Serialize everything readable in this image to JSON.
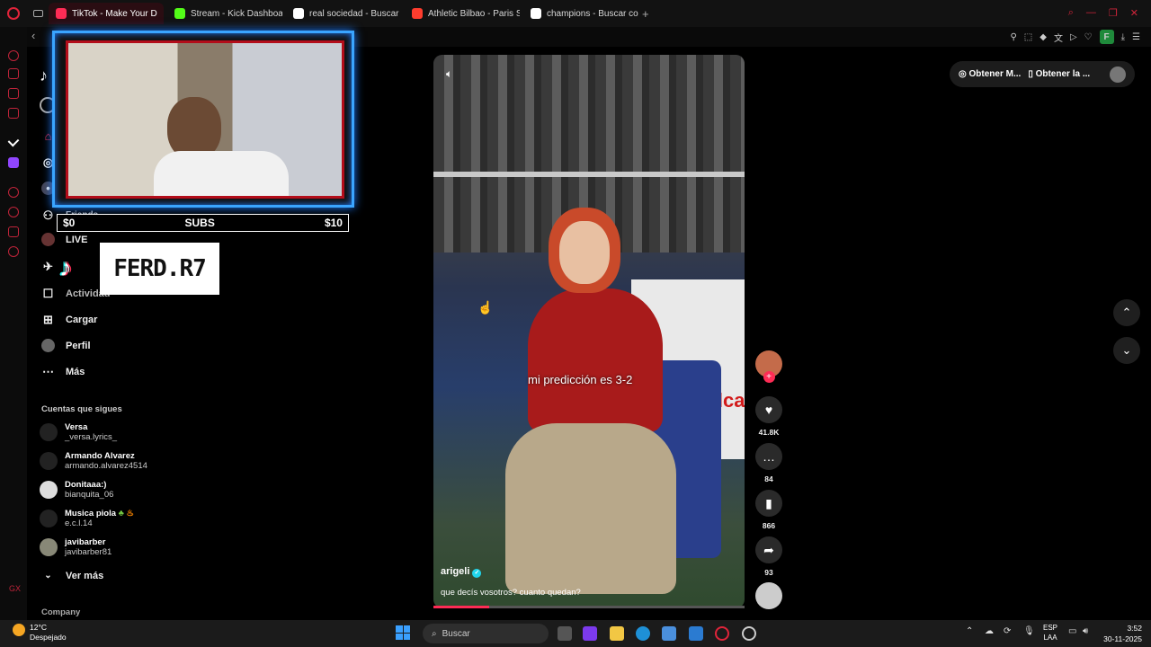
{
  "browser": {
    "tabs": [
      {
        "label": "TikTok - Make Your D",
        "color": "#fe2c55",
        "active": true
      },
      {
        "label": "Stream - Kick Dashboard",
        "color": "#53fc18",
        "active": false
      },
      {
        "label": "real sociedad - Buscar co",
        "color": "#ffffff",
        "active": false
      },
      {
        "label": "Athletic Bilbao - Paris Sai",
        "color": "#ff3d2e",
        "active": false
      },
      {
        "label": "champions - Buscar con",
        "color": "#ffffff",
        "active": false
      }
    ],
    "url": "tiktok.com"
  },
  "sidebar": {
    "nav": [
      {
        "label": "",
        "icon": "home-icon"
      },
      {
        "label": "",
        "icon": "explore-icon"
      },
      {
        "label": "Friends",
        "icon": "friends-icon"
      },
      {
        "label": "LIVE",
        "icon": "live-icon"
      },
      {
        "label": "Actividad",
        "icon": "activity-icon"
      },
      {
        "label": "Cargar",
        "icon": "upload-icon"
      },
      {
        "label": "Perfil",
        "icon": "profile-icon"
      },
      {
        "label": "Más",
        "icon": "more-icon"
      }
    ],
    "following_title": "Cuentas que sigues",
    "following": [
      {
        "name": "Versa",
        "handle": "_versa.lyrics_"
      },
      {
        "name": "Armando Alvarez",
        "handle": "armando.alvarez4514"
      },
      {
        "name": "Donitaaa:)",
        "handle": "bianquita_06"
      },
      {
        "name": "Musica piola",
        "handle": "e.c.l.14"
      },
      {
        "name": "javibarber",
        "handle": "javibarber81"
      }
    ],
    "see_more": "Ver más",
    "company": "Company"
  },
  "overlay": {
    "subs_left": "$0",
    "subs_label": "SUBS",
    "subs_right": "$10",
    "streamer_name": "FERD.R7"
  },
  "video": {
    "caption": "mi predicción es 3-2",
    "author": "arigeli",
    "description": "que decís vosotros? cuanto quedan?",
    "progress": 0.18,
    "sign_text": "Alca"
  },
  "actions": {
    "likes": "41.8K",
    "comments": "84",
    "saves": "866",
    "shares": "93"
  },
  "topright": {
    "btn1": "Obtener M...",
    "btn2": "Obtener la ..."
  },
  "taskbar": {
    "temp": "12°C",
    "weather": "Despejado",
    "search": "Buscar",
    "lang1": "ESP",
    "lang2": "LAA",
    "time": "3:52",
    "date": "30-11-2025"
  }
}
